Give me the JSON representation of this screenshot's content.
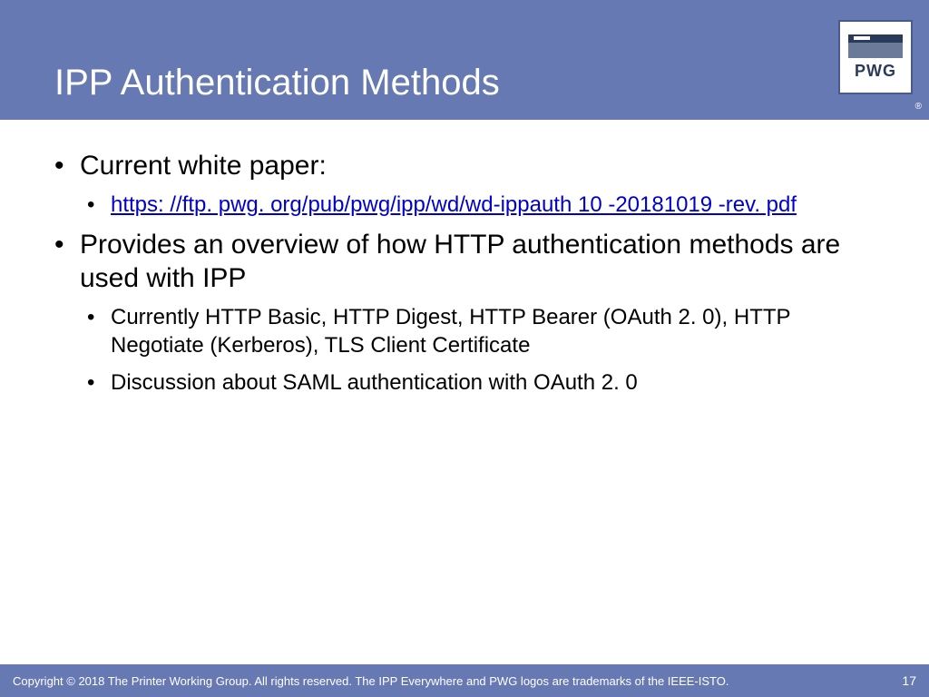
{
  "header": {
    "title": "IPP Authentication Methods",
    "logo_text": "PWG",
    "registered": "®"
  },
  "content": {
    "b1": "Current white paper:",
    "b1_1_link": "https: //ftp. pwg. org/pub/pwg/ipp/wd/wd-ippauth 10 -20181019 -rev. pdf",
    "b2": "Provides an overview of how HTTP authentication methods are used with IPP",
    "b2_1": "Currently HTTP Basic, HTTP Digest, HTTP Bearer (OAuth 2. 0), HTTP Negotiate (Kerberos), TLS Client Certificate",
    "b2_2": "Discussion about SAML authentication with OAuth 2. 0"
  },
  "footer": {
    "copyright": "Copyright © 2018 The Printer Working Group. All rights reserved. The IPP Everywhere and PWG logos are trademarks of the IEEE-ISTO.",
    "page": "17"
  }
}
